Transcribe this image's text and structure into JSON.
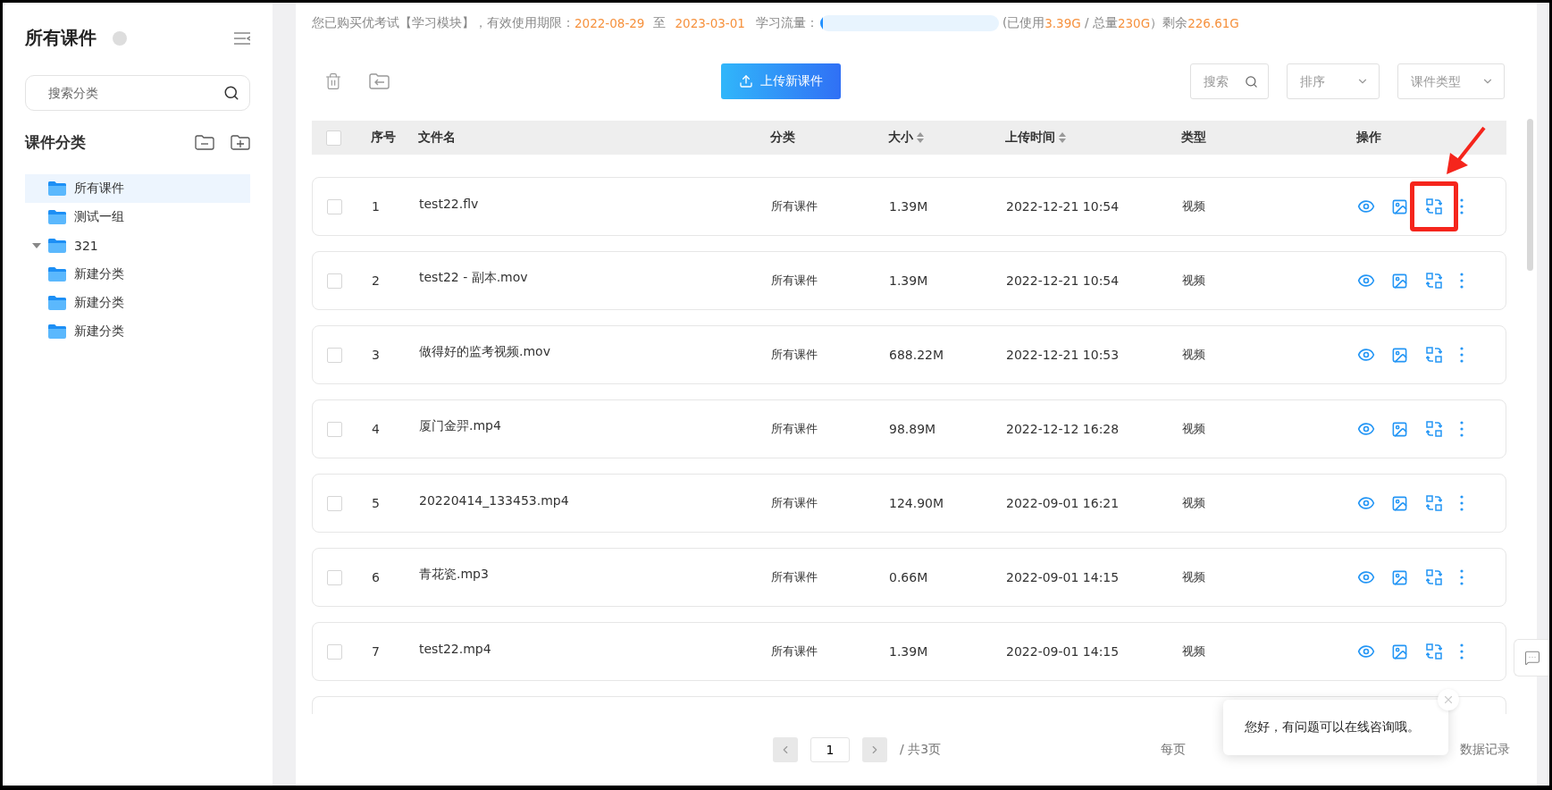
{
  "sidebar": {
    "title": "所有课件",
    "search": {
      "placeholder": "搜索分类"
    },
    "section_title": "课件分类",
    "tree": [
      {
        "label": "所有课件",
        "selected": true
      },
      {
        "label": "测试一组",
        "selected": false
      },
      {
        "label": "321",
        "selected": false,
        "expanded": true,
        "children": [
          {
            "label": "新建分类",
            "selected": false
          },
          {
            "label": "新建分类",
            "selected": false
          },
          {
            "label": "新建分类",
            "selected": false
          }
        ]
      }
    ]
  },
  "info_bar": {
    "purchase": "您已购买优考试【学习模块】，有效使用期限：",
    "start": "2022-08-29",
    "to": "至",
    "end": "2023-03-01",
    "traffic_label": "学习流量：",
    "level": 0.015,
    "used_label": "(已使用",
    "used": "3.39G",
    "sep": " / 总量",
    "total": "230G",
    "remain_label": "）剩余",
    "remain": "226.61G"
  },
  "toolbar": {
    "upload": "上传新课件",
    "search": {
      "placeholder": "搜索"
    },
    "sort": {
      "placeholder": "排序"
    },
    "type": {
      "placeholder": "课件类型"
    }
  },
  "table": {
    "select_all_checked": false,
    "columns": [
      {
        "label": "序号",
        "sortable": false
      },
      {
        "label": "文件名",
        "sortable": false
      },
      {
        "label": "分类",
        "sortable": false
      },
      {
        "label": "大小",
        "sortable": true
      },
      {
        "label": "上传时间",
        "sortable": true
      },
      {
        "label": "类型",
        "sortable": false
      },
      {
        "label": "操作",
        "sortable": false
      }
    ],
    "rows": [
      {
        "no": "1",
        "name": "test22.flv",
        "category": "所有课件",
        "size": "1.39M",
        "time": "2022-12-21 10:54",
        "type": "视频",
        "checked": false,
        "highlighted": true
      },
      {
        "no": "2",
        "name": "test22 - 副本.mov",
        "category": "所有课件",
        "size": "1.39M",
        "time": "2022-12-21 10:54",
        "type": "视频",
        "checked": false,
        "highlighted": false
      },
      {
        "no": "3",
        "name": "做得好的监考视频.mov",
        "category": "所有课件",
        "size": "688.22M",
        "time": "2022-12-21 10:53",
        "type": "视频",
        "checked": false,
        "highlighted": false
      },
      {
        "no": "4",
        "name": "厦门金羿.mp4",
        "category": "所有课件",
        "size": "98.89M",
        "time": "2022-12-12 16:28",
        "type": "视频",
        "checked": false,
        "highlighted": false
      },
      {
        "no": "5",
        "name": "20220414_133453.mp4",
        "category": "所有课件",
        "size": "124.90M",
        "time": "2022-09-01 16:21",
        "type": "视频",
        "checked": false,
        "highlighted": false
      },
      {
        "no": "6",
        "name": "青花瓷.mp3",
        "category": "所有课件",
        "size": "0.66M",
        "time": "2022-09-01 14:15",
        "type": "视频",
        "checked": false,
        "highlighted": false
      },
      {
        "no": "7",
        "name": "test22.mp4",
        "category": "所有课件",
        "size": "1.39M",
        "time": "2022-09-01 14:15",
        "type": "视频",
        "checked": false,
        "highlighted": false
      }
    ]
  },
  "pagination": {
    "page": "1",
    "total": "/ 共3页",
    "per_page": "每页",
    "records": "数据记录"
  },
  "chat_popup": {
    "message": "您好，有问题可以在线咨询哦。"
  }
}
